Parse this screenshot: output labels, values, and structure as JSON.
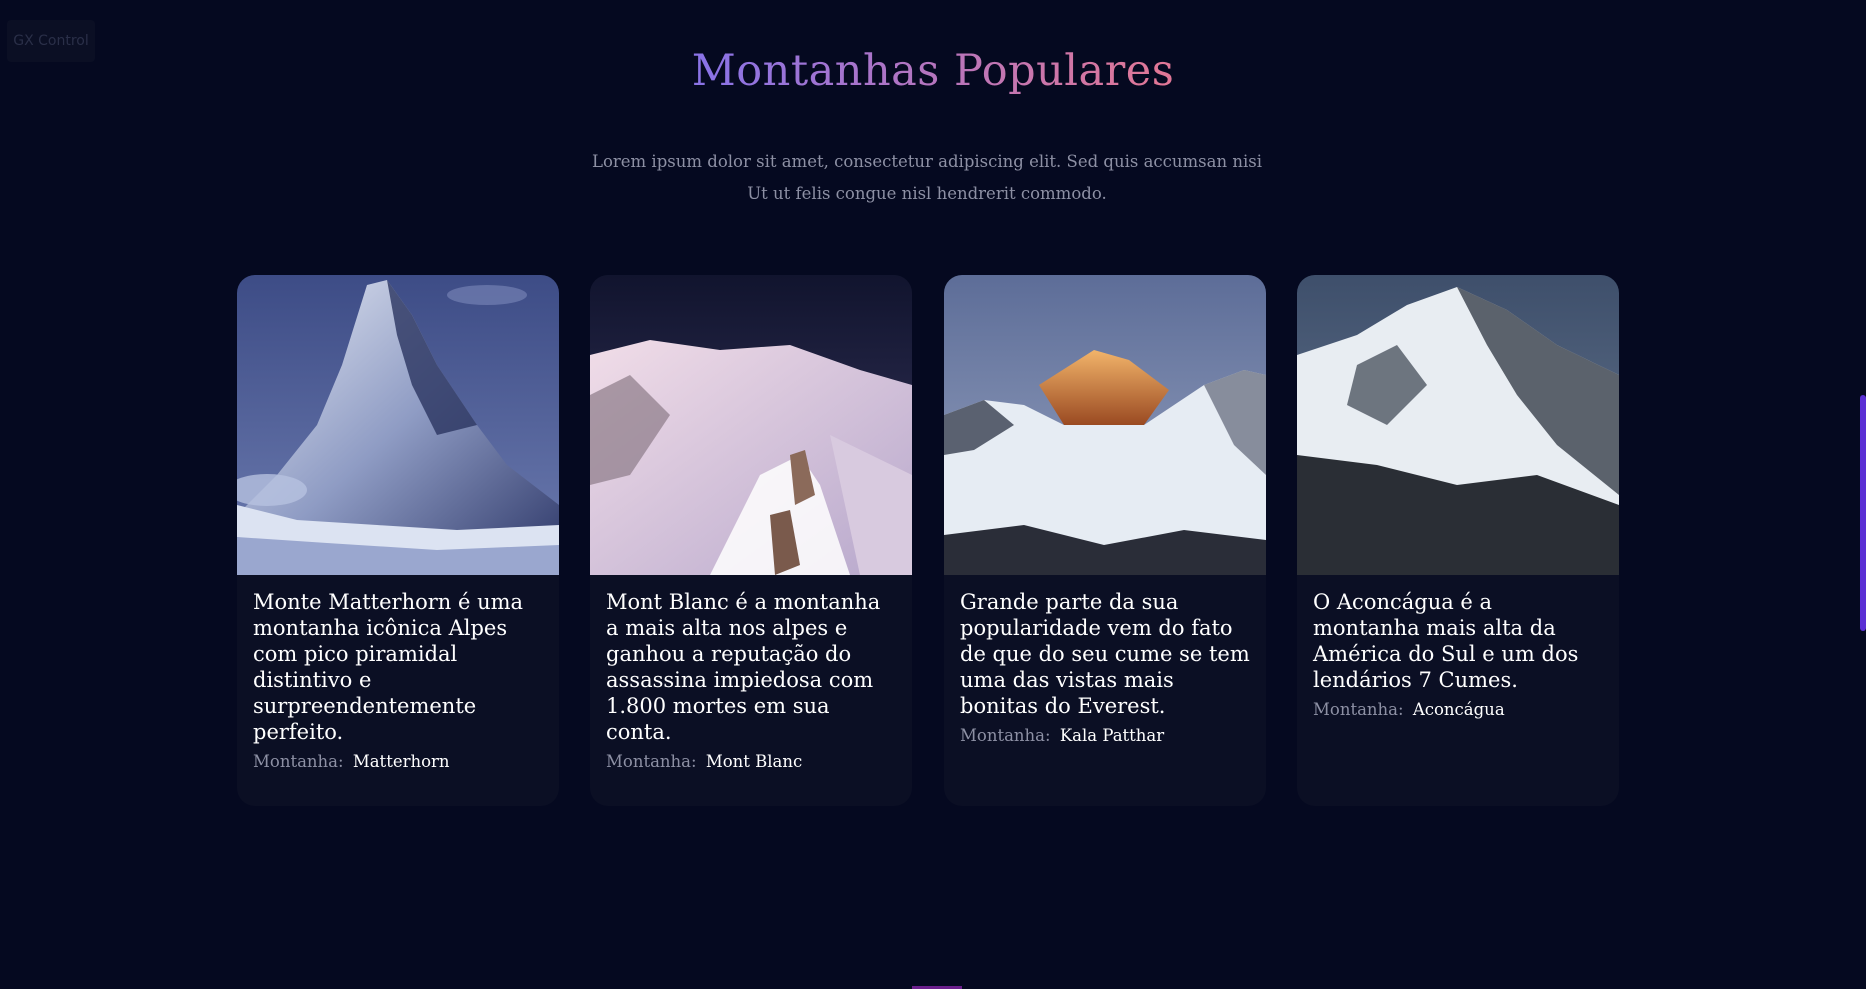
{
  "gx_control": {
    "label": "GX Control"
  },
  "section": {
    "title": "Montanhas Populares",
    "subtitle": "Lorem ipsum dolor sit amet, consectetur adipiscing elit. Sed quis accumsan nisi Ut ut felis congue nisl hendrerit commodo."
  },
  "cards": [
    {
      "description": "Monte Matterhorn é uma montanha icônica Alpes com pico piramidal distintivo e surpreendentemente perfeito.",
      "meta_label": "Montanha:",
      "meta_value": "Matterhorn"
    },
    {
      "description": "Mont Blanc é a montanha a mais alta nos alpes e ganhou a reputação do assassina impiedosa com 1.800 mortes em sua conta.",
      "meta_label": "Montanha:",
      "meta_value": "Mont Blanc"
    },
    {
      "description": "Grande parte da sua popularidade vem do fato de que do seu cume se tem uma das vistas mais bonitas do Everest.",
      "meta_label": "Montanha:",
      "meta_value": "Kala Patthar"
    },
    {
      "description": "O Aconcágua é a montanha mais alta da América do Sul e um dos lendários 7 Cumes.",
      "meta_label": "Montanha:",
      "meta_value": "Aconcágua"
    }
  ],
  "colors": {
    "background": "#050920",
    "card_background": "#0b0f24",
    "title_gradient_start": "#8b73e6",
    "title_gradient_end": "#e07797",
    "muted_text": "#8d90a4",
    "scrollbar": "#5a2fd4"
  }
}
